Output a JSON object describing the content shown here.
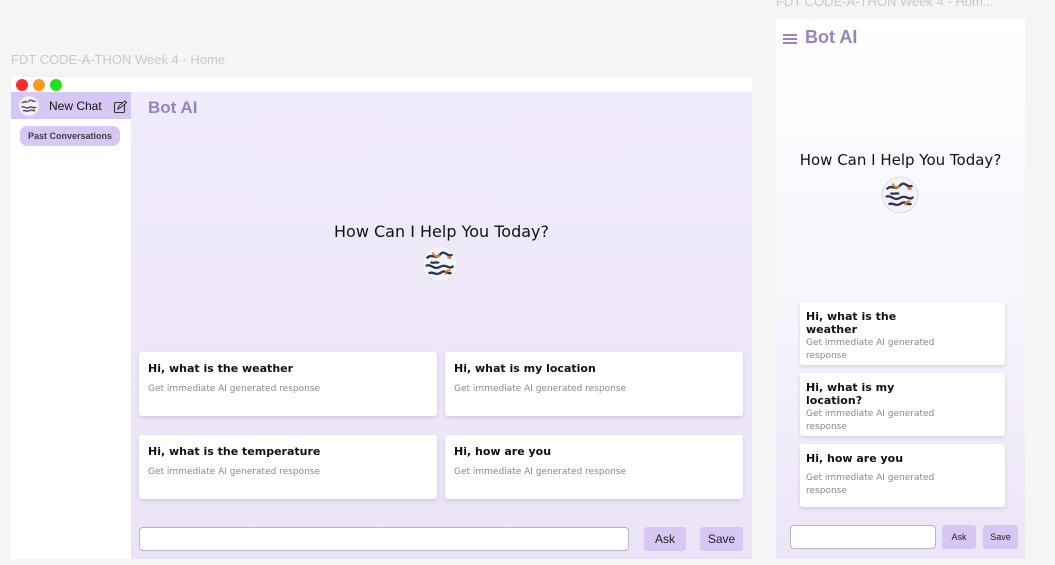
{
  "frames": {
    "desktop_title": "FDT CODE-A-THON Week 4 - Home",
    "mobile_title": "FDT CODE-A-THON Week 4 - Hom..."
  },
  "sidebar": {
    "new_chat_label": "New Chat",
    "past_conversations_label": "Past Conversations"
  },
  "app": {
    "brand": "Bot AI",
    "hero_title": "How Can I Help You Today?"
  },
  "suggestions": [
    {
      "title": "Hi, what is the weather",
      "subtitle": "Get immediate AI generated response"
    },
    {
      "title": "Hi, what is my location",
      "subtitle": "Get immediate AI generated response"
    },
    {
      "title": "Hi, what is the temperature",
      "subtitle": "Get immediate AI generated response"
    },
    {
      "title": "Hi, how are you",
      "subtitle": "Get immediate AI generated response"
    }
  ],
  "mobile_suggestions": [
    {
      "title": "Hi, what is the weather",
      "subtitle": "Get immediate AI generated response"
    },
    {
      "title": "Hi, what is my location?",
      "subtitle": "Get immediate AI generated response"
    },
    {
      "title": "Hi, how are you",
      "subtitle": "Get immediate AI generated response"
    }
  ],
  "input": {
    "value": "",
    "ask_label": "Ask",
    "save_label": "Save"
  },
  "colors": {
    "accent": "#d7c7f4",
    "brand": "#9785ba",
    "main_bg": "#efe9fa"
  },
  "icons": {
    "window_controls": [
      "close-dot",
      "minimize-dot",
      "maximize-dot"
    ],
    "edit": "edit-icon",
    "menu": "hamburger-menu-icon",
    "logo": "bot-logo"
  }
}
